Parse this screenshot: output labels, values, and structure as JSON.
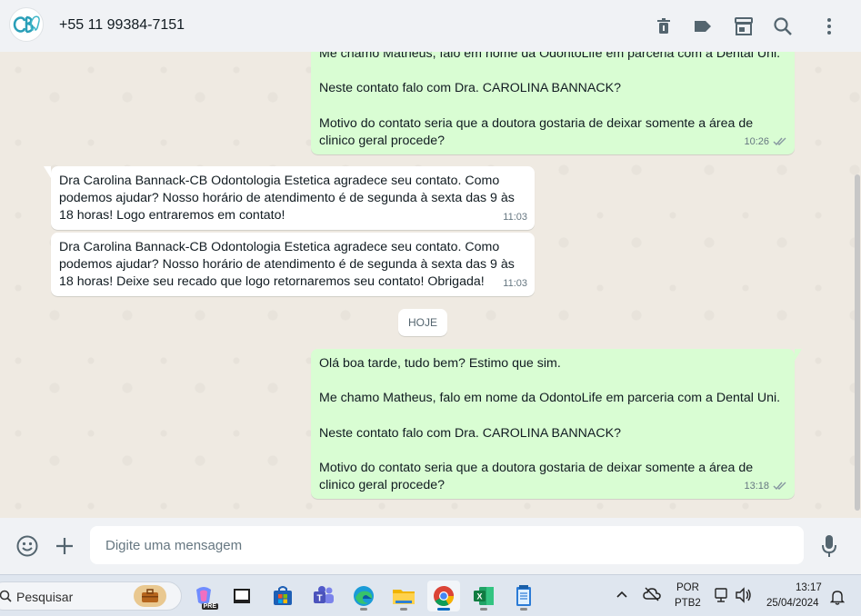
{
  "header": {
    "avatar_text": "CB",
    "contact_name": "+55 11 99384-7151",
    "icons": [
      "trash-icon",
      "label-icon",
      "store-icon",
      "search-icon",
      "menu-icon"
    ]
  },
  "messages": [
    {
      "direction": "out",
      "text": "Me chamo Matheus, falo em nome da OdontoLife em parceria com a Dental Uni.\n\nNeste contato falo com Dra. CAROLINA BANNACK?\n\nMotivo do contato seria que a doutora gostaria de deixar somente a área de clinico geral procede?",
      "time": "10:26"
    },
    {
      "direction": "in",
      "text": "Dra Carolina Bannack-CB Odontologia Estetica agradece seu contato. Como podemos ajudar? Nosso horário de atendimento é de segunda à sexta das 9 às 18 horas! Logo entraremos em contato!",
      "time": "11:03"
    },
    {
      "direction": "in",
      "text": "Dra Carolina Bannack-CB Odontologia Estetica agradece seu contato. Como podemos ajudar? Nosso horário de atendimento é de segunda à sexta das 9 às 18 horas! Deixe seu recado que logo retornaremos seu contato! Obrigada!",
      "time": "11:03"
    },
    {
      "direction": "out",
      "text": "Olá boa tarde, tudo bem? Estimo que sim.\n\nMe chamo Matheus, falo em nome da OdontoLife em parceria com a Dental Uni.\n\nNeste contato falo com Dra. CAROLINA BANNACK?\n\nMotivo do contato seria que a doutora gostaria de deixar somente a área de clinico geral procede?",
      "time": "13:18"
    }
  ],
  "date_divider": "HOJE",
  "composer": {
    "placeholder": "Digite uma mensagem",
    "icons": [
      "emoji-icon",
      "attach-plus-icon",
      "microphone-icon"
    ]
  },
  "taskbar": {
    "search_label": "Pesquisar",
    "apps": [
      "briefcase-icon",
      "copilot-icon",
      "app-window-icon",
      "microsoft-store-icon",
      "teams-icon",
      "edge-icon",
      "file-explorer-icon",
      "chrome-icon",
      "excel-icon",
      "notepad-icon"
    ],
    "copilot_badge": "PRE",
    "language": "POR",
    "keyboard": "PTB2",
    "time": "13:17",
    "date": "25/04/2024"
  },
  "colors": {
    "chat_bg": "#efeae2",
    "outgoing_bubble": "#d9fdd3",
    "incoming_bubble": "#ffffff",
    "header_bg": "#f0f2f5",
    "ticks": "#8696a0"
  }
}
